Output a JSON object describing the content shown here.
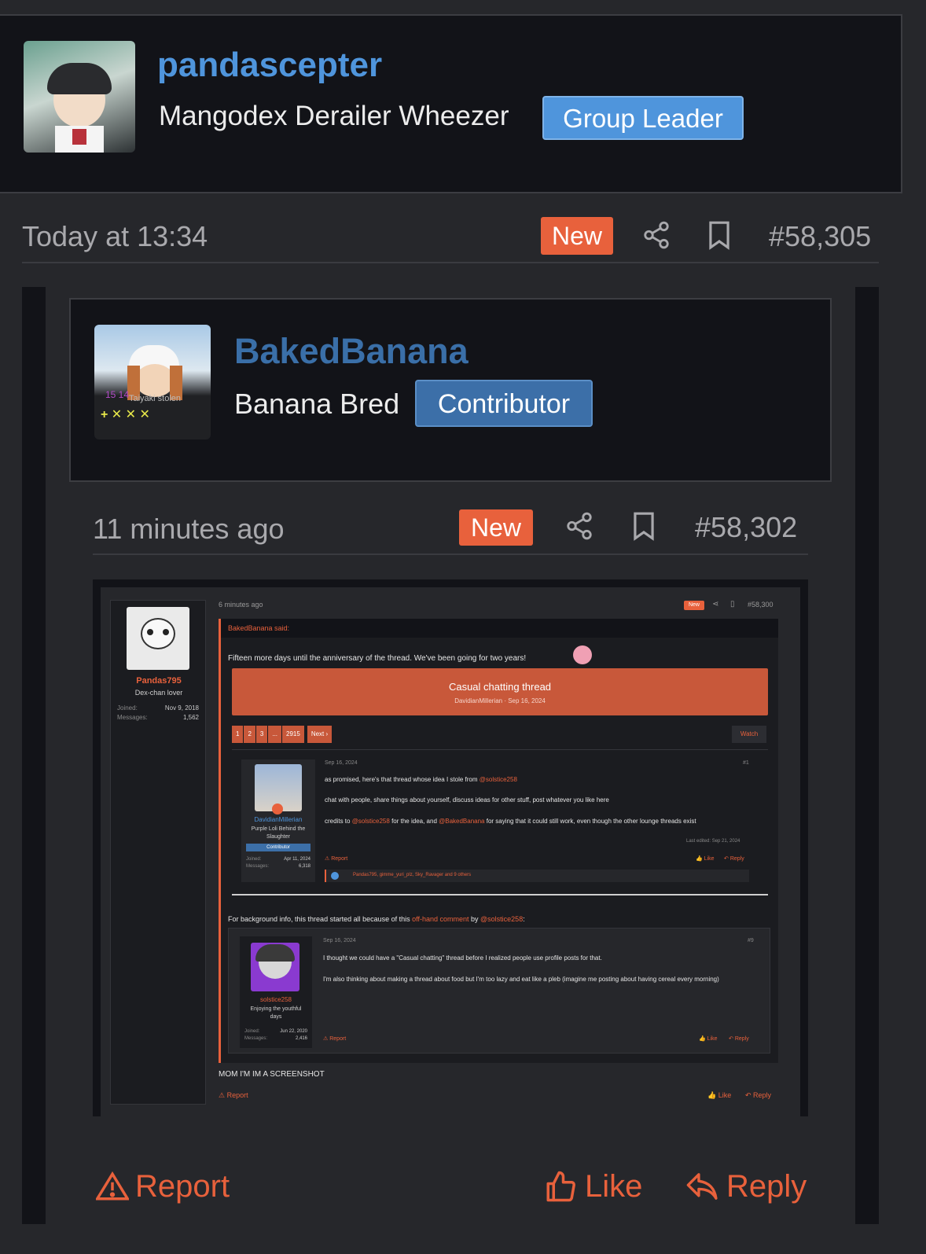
{
  "top_user": {
    "username": "pandascepter",
    "title": "Mangodex Derailer Wheezer",
    "badge": "Group Leader"
  },
  "top_post_meta": {
    "time": "Today at 13:34",
    "new_badge": "New",
    "post_number": "#58,305"
  },
  "inner_user": {
    "username": "BakedBanana",
    "title": "Banana Bred",
    "badge": "Contributor",
    "avatar_text": "Taiyaki stolen"
  },
  "inner_post_meta": {
    "time": "11 minutes ago",
    "new_badge": "New",
    "post_number": "#58,302"
  },
  "screenshot": {
    "user": {
      "username": "Pandas795",
      "title": "Dex-chan lover",
      "joined_label": "Joined:",
      "joined": "Nov 9, 2018",
      "messages_label": "Messages:",
      "messages": "1,562"
    },
    "meta": {
      "time": "6 minutes ago",
      "new_badge": "New",
      "post_number": "#58,300"
    },
    "quote_header": "BakedBanana said:",
    "intro_text": "Fifteen more days until the anniversary of the thread. We've been going for two years!",
    "thread_card": {
      "title": "Casual chatting thread",
      "meta": "DavidianMillerian · Sep 16, 2024"
    },
    "pagination": [
      "1",
      "2",
      "3",
      "...",
      "2915",
      "Next ›"
    ],
    "watch_label": "Watch",
    "post1": {
      "username": "DavidianMillerian",
      "title": "Purple Loli Behind the Slaughter",
      "badge": "Contributor",
      "joined_label": "Joined:",
      "joined": "Apr 11, 2024",
      "messages_label": "Messages:",
      "messages": "6,318",
      "date": "Sep 16, 2024",
      "number": "#1",
      "line1_pre": "as promised, here's that thread whose idea I stole from ",
      "line1_mention": "@solstice258",
      "line2": "chat with people, share things about yourself, discuss ideas for other stuff, post whatever you like here",
      "line3_a": "credits to ",
      "line3_m1": "@solstice258",
      "line3_b": " for the idea, and ",
      "line3_m2": "@BakedBanana",
      "line3_c": " for saying that it could still work, even though the other lounge threads exist",
      "last_edited": "Last edited: Sep 21, 2024",
      "report": "Report",
      "like": "Like",
      "reply": "Reply",
      "reactions": "Pandas795, gimme_yuri_plz, Sky_Ravager and 9 others"
    },
    "background_line": {
      "pre": "For background info, this thread started all because of this ",
      "link": "off-hand comment",
      "mid": " by ",
      "mention": "@solstice258",
      "post": ":"
    },
    "post2": {
      "username": "solstice258",
      "title": "Enjoying the youthful days",
      "joined_label": "Joined:",
      "joined": "Jun 22, 2020",
      "messages_label": "Messages:",
      "messages": "2,416",
      "date": "Sep 16, 2024",
      "number": "#9",
      "line1": "I thought we could have a \"Casual chatting\" thread before I realized people use profile posts for that.",
      "line2": "I'm also thinking about making a thread about food but I'm too lazy and eat like a pleb (imagine me posting about having cereal every morning)",
      "report": "Report",
      "like": "Like",
      "reply": "Reply"
    },
    "body_text": "MOM I'M IM A SCREENSHOT",
    "report": "Report",
    "like": "Like",
    "reply": "Reply"
  },
  "actions": {
    "report": "Report",
    "like": "Like",
    "reply": "Reply"
  },
  "colors": {
    "accent": "#e8613c",
    "group_leader_badge": "#4f95dc",
    "contributor_badge": "#3c6fa8",
    "username_blue": "#4f95dc",
    "inner_username_blue": "#3a6fa8"
  }
}
